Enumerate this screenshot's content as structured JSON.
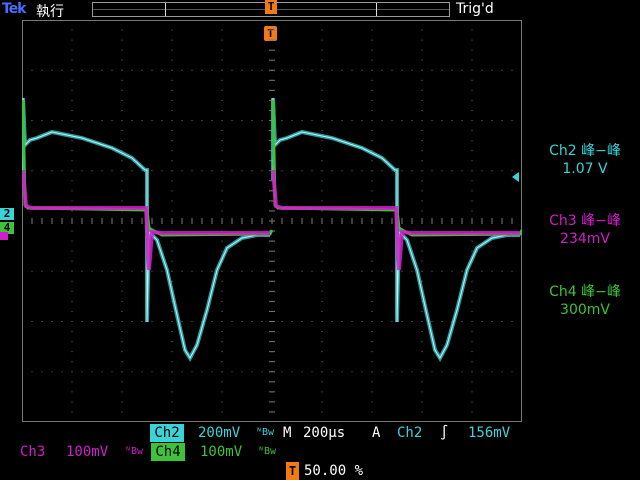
{
  "header": {
    "brand": "Tek",
    "run_state": "執行",
    "trigger_status": "Trig'd",
    "trigger_marker": "T"
  },
  "channel_markers": {
    "ch2": "2",
    "ch4": "4"
  },
  "measurements": [
    {
      "channel": "Ch2",
      "label": "Ch2 峰−峰",
      "value": "1.07 V",
      "color": "#39d3d8"
    },
    {
      "channel": "Ch3",
      "label": "Ch3 峰−峰",
      "value": "234mV",
      "color": "#d01fc8"
    },
    {
      "channel": "Ch4",
      "label": "Ch4 峰−峰",
      "value": "300mV",
      "color": "#3ec23a"
    }
  ],
  "status_bar": {
    "ch2_name": "Ch2",
    "ch2_scale": "200mV",
    "ch2_bw": "ᴺBw",
    "timebase_prefix": "M",
    "timebase": "200µs",
    "trigger_mode": "A",
    "trigger_source": "Ch2",
    "trigger_slope": "∫",
    "trigger_level": "156mV",
    "ch3_name": "Ch3",
    "ch3_scale": "100mV",
    "ch3_bw": "ᴺBw",
    "ch4_name": "Ch4",
    "ch4_scale": "100mV",
    "ch4_bw": "ᴺBw",
    "trigger_position_icon": "T",
    "trigger_position": "50.00 %"
  },
  "colors": {
    "ch2": "#39d3d8",
    "ch3": "#d01fc8",
    "ch4": "#3ec23a",
    "trigger": "#f07a18",
    "grid": "#777777"
  }
}
